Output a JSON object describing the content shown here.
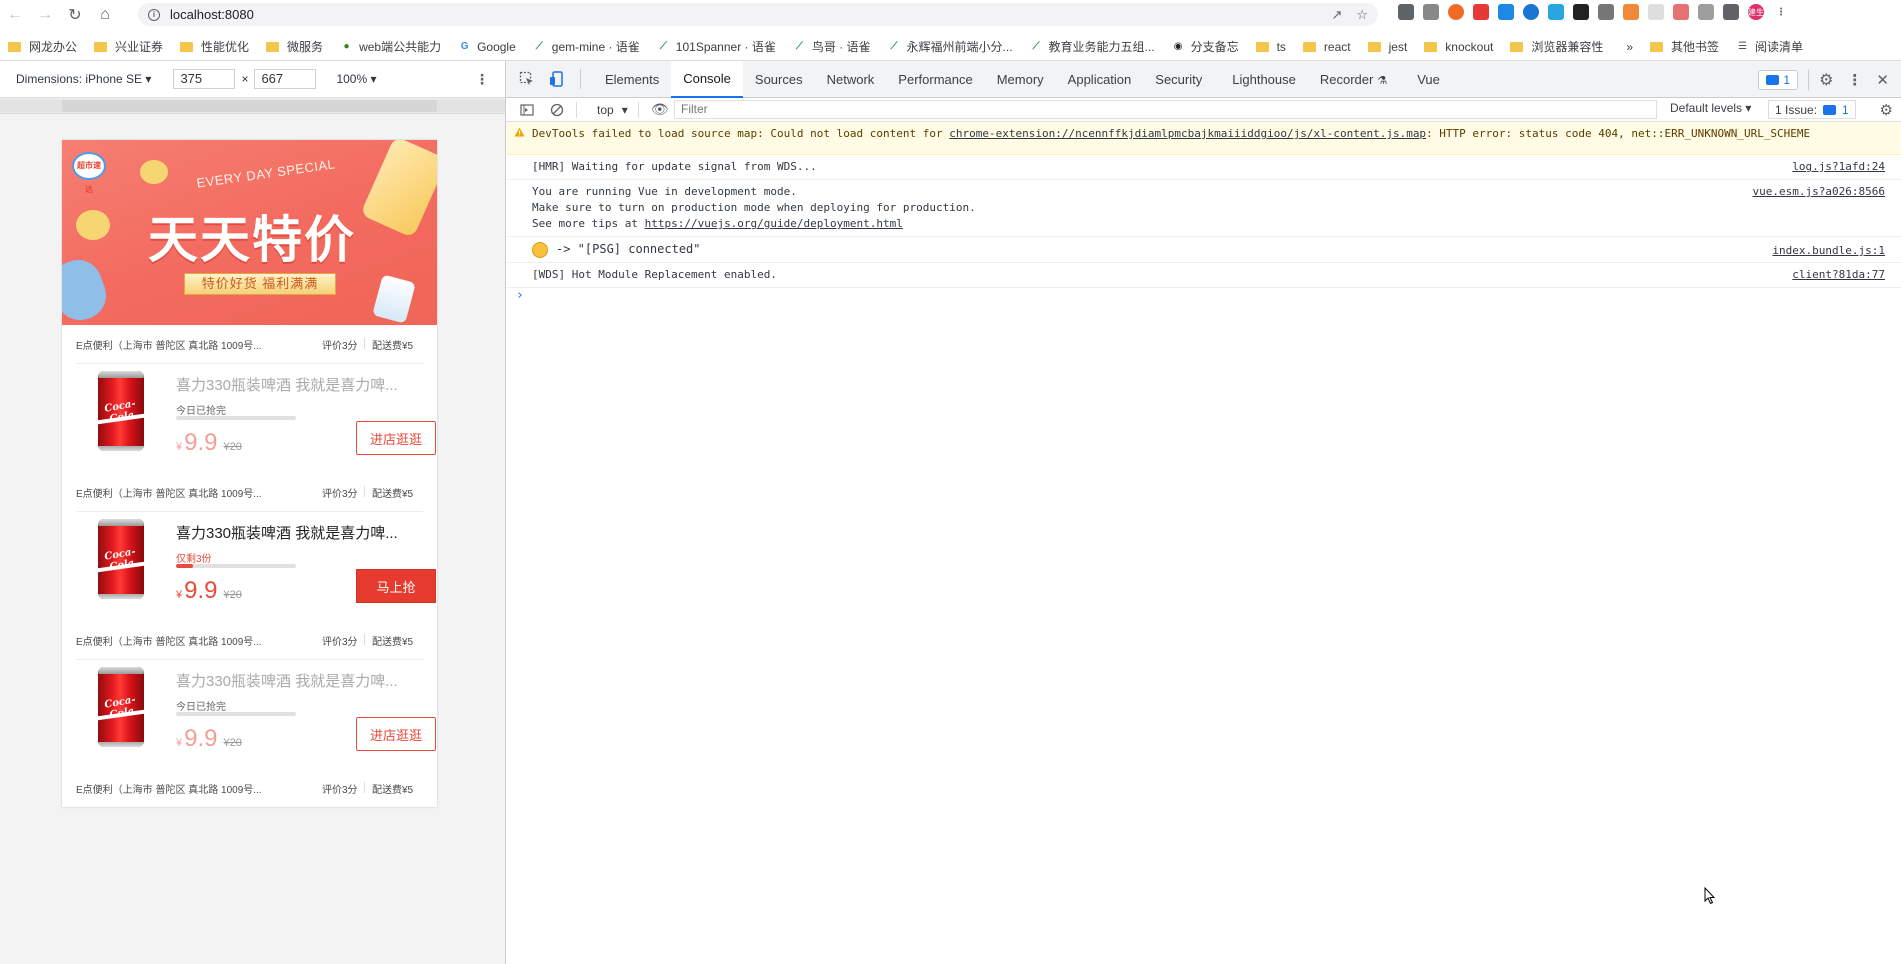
{
  "browser": {
    "url": "localhost:8080",
    "bookmarks": [
      {
        "label": "网龙办公",
        "type": "folder"
      },
      {
        "label": "兴业证券",
        "type": "folder"
      },
      {
        "label": "性能优化",
        "type": "folder"
      },
      {
        "label": "微服务",
        "type": "folder"
      },
      {
        "label": "web端公共能力",
        "type": "site",
        "icon": "globe-icon"
      },
      {
        "label": "Google",
        "type": "site",
        "icon": "google-icon"
      },
      {
        "label": "gem-mine · 语雀",
        "type": "site",
        "icon": "yuque-icon"
      },
      {
        "label": "101Spanner · 语雀",
        "type": "site",
        "icon": "yuque-icon"
      },
      {
        "label": "鸟哥 · 语雀",
        "type": "site",
        "icon": "yuque-icon"
      },
      {
        "label": "永辉福州前端小分...",
        "type": "site",
        "icon": "yuque-icon"
      },
      {
        "label": "教育业务能力五组...",
        "type": "site",
        "icon": "yuque-icon"
      },
      {
        "label": "分支备忘",
        "type": "site",
        "icon": "owl-icon"
      },
      {
        "label": "ts",
        "type": "folder"
      },
      {
        "label": "react",
        "type": "folder"
      },
      {
        "label": "jest",
        "type": "folder"
      },
      {
        "label": "knockout",
        "type": "folder"
      },
      {
        "label": "浏览器兼容性",
        "type": "folder"
      }
    ],
    "bookmarks_more": "»",
    "other_bookmarks": "其他书签",
    "reading_list": "阅读清单",
    "profile_label": "建生"
  },
  "device_toolbar": {
    "dimensions_label": "Dimensions: iPhone SE",
    "width": "375",
    "height": "667",
    "zoom": "100%"
  },
  "page": {
    "banner": {
      "badge": "超市速达",
      "subtitle": "EVERY DAY SPECIAL",
      "title": "天天特价",
      "ribbon": "特价好货  福利满满"
    },
    "shops": [
      {
        "name": "E点便利（上海市 普陀区 真北路 1009号...",
        "score": "评价3分",
        "fee": "配送费¥5"
      },
      {
        "name": "E点便利（上海市 普陀区 真北路 1009号...",
        "score": "评价3分",
        "fee": "配送费¥5"
      },
      {
        "name": "E点便利（上海市 普陀区 真北路 1009号...",
        "score": "评价3分",
        "fee": "配送费¥5"
      },
      {
        "name": "E点便利（上海市 普陀区 真北路 1009号...",
        "score": "评价3分",
        "fee": "配送费¥5"
      }
    ],
    "products": [
      {
        "title": "喜力330瓶装啤酒 我就是喜力啤...",
        "status": "今日已抢完",
        "progress": 0,
        "currency": "¥",
        "price": "9.9",
        "old_price": "¥20",
        "button": "进店逛逛",
        "state": "soldout",
        "image_text": "Coca-Cola"
      },
      {
        "title": "喜力330瓶装啤酒 我就是喜力啤...",
        "status": "仅剩3份",
        "progress": 0.14,
        "currency": "¥",
        "price": "9.9",
        "old_price": "¥20",
        "button": "马上抢",
        "state": "active",
        "image_text": "Coca-Cola"
      },
      {
        "title": "喜力330瓶装啤酒 我就是喜力啤...",
        "status": "今日已抢完",
        "progress": 0,
        "currency": "¥",
        "price": "9.9",
        "old_price": "¥20",
        "button": "进店逛逛",
        "state": "soldout",
        "image_text": "Coca-Cola"
      }
    ]
  },
  "devtools": {
    "tabs": [
      "Elements",
      "Console",
      "Sources",
      "Network",
      "Performance",
      "Memory",
      "Application",
      "Security",
      "Lighthouse",
      "Recorder",
      "Vue"
    ],
    "active_tab": "Console",
    "recorder_flask": "⚗",
    "issue_count": "1",
    "console": {
      "context": "top",
      "filter_placeholder": "Filter",
      "levels": "Default levels",
      "issues_label": "1 Issue:",
      "issues_count": "1"
    },
    "messages": [
      {
        "type": "warning",
        "text_pre": "DevTools failed to load source map: Could not load content for ",
        "link": "chrome-extension://ncennffkjdiamlpmcbajkmaiiiddgioo/js/xl-content.js.map",
        "text_post": ": HTTP error: status code 404, net::ERR_UNKNOWN_URL_SCHEME"
      },
      {
        "type": "log",
        "text": "[HMR] Waiting for update signal from WDS...",
        "source": "log.js?1afd:24"
      },
      {
        "type": "log",
        "line1": "You are running Vue in development mode.",
        "line2": "Make sure to turn on production mode when deploying for production.",
        "line3_pre": "See more tips at ",
        "line3_link": "https://vuejs.org/guide/deployment.html",
        "source": "vue.esm.js?a026:8566"
      },
      {
        "type": "log",
        "text": "-> \"[PSG] connected\"",
        "source": "index.bundle.js:1"
      },
      {
        "type": "log",
        "text": "[WDS] Hot Module Replacement enabled.",
        "source": "client?81da:77"
      }
    ],
    "prompt": "›"
  },
  "colors": {
    "accent": "#e94a3b",
    "devtools_blue": "#1a73e8",
    "warning_bg": "#fffbe5"
  }
}
